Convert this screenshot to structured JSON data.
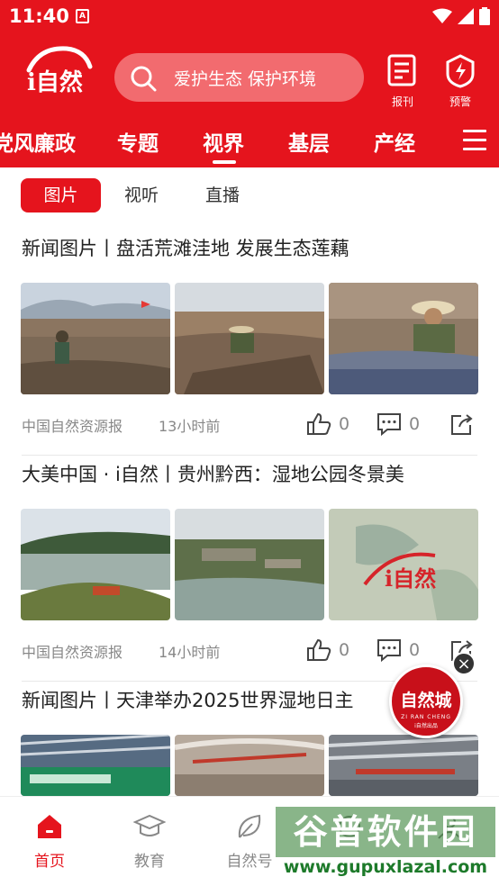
{
  "status": {
    "time": "11:40",
    "notif_glyph": "A"
  },
  "header": {
    "logo_text": "i自然",
    "search_placeholder": "爱护生态 保护环境",
    "newspaper_label": "报刊",
    "alert_label": "预警",
    "brand_color": "#e5141d"
  },
  "nav": {
    "items": [
      "党风廉政",
      "专题",
      "视界",
      "基层",
      "产经"
    ],
    "active": "视界"
  },
  "subtabs": {
    "items": [
      "图片",
      "视听",
      "直播"
    ],
    "active": "图片"
  },
  "articles": [
    {
      "title": "新闻图片丨盘活荒滩洼地  发展生态莲藕",
      "source": "中国自然资源报",
      "time": "13小时前",
      "likes": "0",
      "comments": "0"
    },
    {
      "title": "大美中国 · i自然丨贵州黔西：湿地公园冬景美",
      "source": "中国自然资源报",
      "time": "14小时前",
      "likes": "0",
      "comments": "0"
    },
    {
      "title": "新闻图片丨天津举办2025世界湿地日主"
    }
  ],
  "float_ad": {
    "title": "自然城",
    "sub": "ZI RAN CHENG",
    "sub2": "i自然出品"
  },
  "bottom_nav": {
    "items": [
      "首页",
      "教育",
      "自然号",
      "",
      ""
    ],
    "active": "首页"
  },
  "watermark": {
    "text": "谷普软件园",
    "url": "www.gupuxlazal.com"
  }
}
